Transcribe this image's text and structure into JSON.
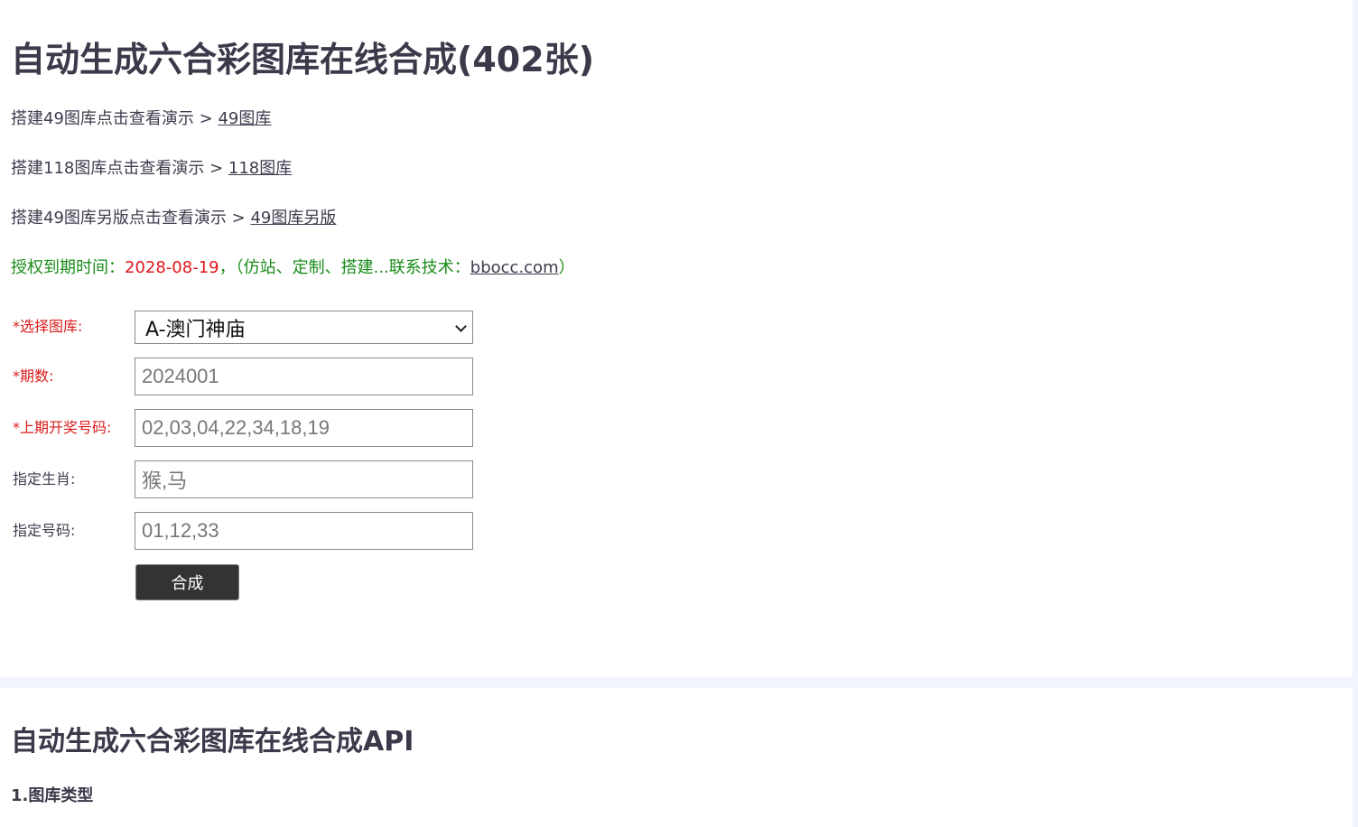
{
  "page": {
    "title": "自动生成六合彩图库在线合成(402张)"
  },
  "demos": [
    {
      "text": "搭建49图库点击查看演示 > ",
      "link": "49图库"
    },
    {
      "text": "搭建118图库点击查看演示 > ",
      "link": "118图库"
    },
    {
      "text": "搭建49图库另版点击查看演示 > ",
      "link": "49图库另版"
    }
  ],
  "license": {
    "label": "授权到期时间：",
    "date": "2028-08-19",
    "note_prefix": "，（仿站、定制、搭建...联系技术：",
    "contact_link": "bbocc.com",
    "note_suffix": "）",
    "colors": {
      "label": "#1a8c1a",
      "date": "#e0161c"
    }
  },
  "form": {
    "gallery_label": "*选择图库:",
    "gallery_selected": "A-澳门神庙",
    "issue_label": "*期数:",
    "issue_placeholder": "2024001",
    "last_numbers_label": "*上期开奖号码:",
    "last_numbers_placeholder": "02,03,04,22,34,18,19",
    "zodiac_label": "指定生肖:",
    "zodiac_placeholder": "猴,马",
    "numbers_label": "指定号码:",
    "numbers_placeholder": "01,12,33",
    "submit_label": "合成",
    "colors": {
      "required_label": "#d91d1d",
      "button_bg": "#333333"
    }
  },
  "api": {
    "title": "自动生成六合彩图库在线合成API",
    "section1": "1.图库类型"
  }
}
